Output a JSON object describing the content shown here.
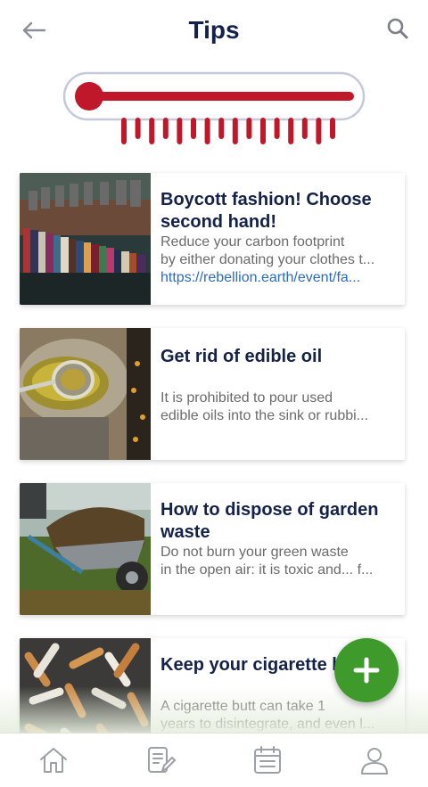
{
  "header": {
    "title": "Tips",
    "back_icon": "arrow-left-icon",
    "search_icon": "search-icon"
  },
  "thermometer": {
    "icon": "thermometer-icon",
    "color": "#c0182a",
    "outline": "#b9c0d6"
  },
  "tips": [
    {
      "title": "Boycott fashion! Choose second hand!",
      "desc_line1": "Reduce your carbon footprint",
      "desc_line2": "by either donating your clothes t...",
      "link": "https://rebellion.earth/event/fa...",
      "image": "clothing-store-image"
    },
    {
      "title": "Get rid of edible oil",
      "desc_line1": "It is prohibited to pour used",
      "desc_line2": "edible oils into the sink or rubbi...",
      "image": "frying-oil-image"
    },
    {
      "title": "How to dispose of garden waste",
      "desc_line1": "Do not burn your green waste",
      "desc_line2": "in the open air: it is toxic and... f...",
      "image": "wheelbarrow-image"
    },
    {
      "title": "Keep your cigarette b",
      "desc_line1": "A cigarette butt can take 1",
      "desc_line2": "years to disintegrate, and even l...",
      "image": "cigarette-butts-image"
    }
  ],
  "fab": {
    "icon": "plus-icon",
    "color": "#3f9a2c"
  },
  "bottom_nav": [
    {
      "icon": "home-icon"
    },
    {
      "icon": "edit-document-icon"
    },
    {
      "icon": "calendar-icon"
    },
    {
      "icon": "profile-icon"
    }
  ],
  "colors": {
    "title": "#14214a",
    "text": "#6b6b6b",
    "link": "#2a6bc4",
    "accent": "#3f9a2c"
  }
}
